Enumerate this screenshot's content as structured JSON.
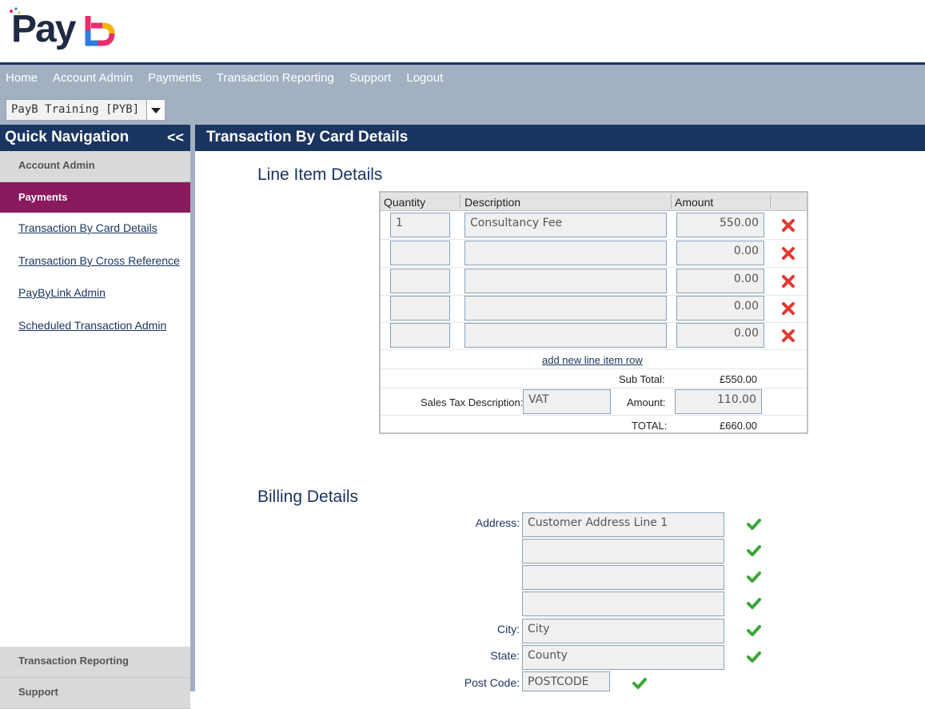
{
  "brand": {
    "logo_text": "Payb"
  },
  "nav": {
    "items": [
      "Home",
      "Account Admin",
      "Payments",
      "Transaction Reporting",
      "Support",
      "Logout"
    ]
  },
  "org_select": {
    "value": "PayB Training [PYB]"
  },
  "sidebar": {
    "title": "Quick Navigation",
    "collapse": "<<",
    "sections": {
      "account_admin": "Account Admin",
      "payments": "Payments",
      "transaction_reporting": "Transaction Reporting",
      "support": "Support"
    },
    "links": [
      "Transaction By Card Details",
      "Transaction By Cross Reference",
      "PayByLink Admin",
      "Scheduled Transaction Admin"
    ]
  },
  "page": {
    "title": "Transaction By Card Details"
  },
  "line_items": {
    "section_title": "Line Item Details",
    "headers": {
      "quantity": "Quantity",
      "description": "Description",
      "amount": "Amount"
    },
    "rows": [
      {
        "quantity": "1",
        "description": "Consultancy Fee",
        "amount": "550.00"
      },
      {
        "quantity": "",
        "description": "",
        "amount": "0.00"
      },
      {
        "quantity": "",
        "description": "",
        "amount": "0.00"
      },
      {
        "quantity": "",
        "description": "",
        "amount": "0.00"
      },
      {
        "quantity": "",
        "description": "",
        "amount": "0.00"
      }
    ],
    "add_row_link": "add new line item row",
    "subtotal_label": "Sub Total:",
    "subtotal_value": "£550.00",
    "tax_desc_label": "Sales Tax Description:",
    "tax_desc_value": "VAT",
    "tax_amount_label": "Amount:",
    "tax_amount_value": "110.00",
    "total_label": "TOTAL:",
    "total_value": "£660.00"
  },
  "billing": {
    "section_title": "Billing Details",
    "address_label": "Address:",
    "address_lines": [
      "Customer Address Line 1",
      "",
      "",
      ""
    ],
    "city_label": "City:",
    "city": "City",
    "state_label": "State:",
    "state": "County",
    "postcode_label": "Post Code:",
    "postcode": "POSTCODE"
  },
  "colors": {
    "navy": "#1a3560",
    "magenta": "#8a1a5e",
    "nav_bg": "#a3b0c2",
    "delete_red": "#e03a2f",
    "check_green": "#3aa63a"
  }
}
